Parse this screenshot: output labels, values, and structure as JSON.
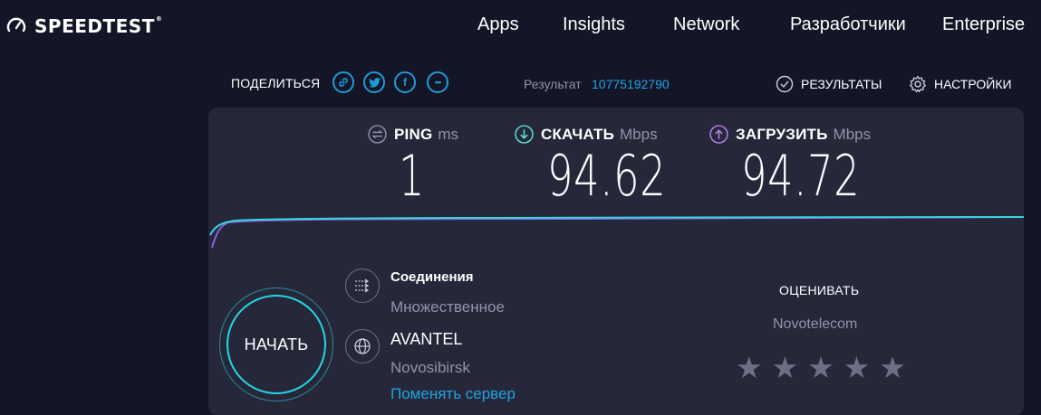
{
  "header": {
    "logo": "SPEEDTEST",
    "logo_tm": "®",
    "nav": [
      "Apps",
      "Insights",
      "Network",
      "Разработчики",
      "Enterprise"
    ]
  },
  "share": {
    "label": "ПОДЕЛИТЬСЯ",
    "buttons": [
      "link-icon",
      "twitter-icon",
      "facebook-icon",
      "more-icon"
    ],
    "facebook_glyph": "f",
    "more_glyph": "•••"
  },
  "result": {
    "label": "Результат",
    "id": "10775192790"
  },
  "links": {
    "results": "РЕЗУЛЬТАТЫ",
    "settings": "НАСТРОЙКИ"
  },
  "metrics": {
    "ping": {
      "name": "PING",
      "unit": "ms",
      "value": "1"
    },
    "download": {
      "name": "СКАЧАТЬ",
      "unit": "Mbps",
      "value": "94.62"
    },
    "upload": {
      "name": "ЗАГРУЗИТЬ",
      "unit": "Mbps",
      "value": "94.72"
    }
  },
  "start_button": "НАЧАТЬ",
  "connections": {
    "title": "Соединения",
    "value": "Множественное"
  },
  "server": {
    "name": "AVANTEL",
    "city": "Novosibirsk",
    "change": "Поменять сервер"
  },
  "rating": {
    "label": "ОЦЕНИВАТЬ",
    "isp": "Novotelecom",
    "stars": 5,
    "star_glyph": "★"
  },
  "colors": {
    "background": "#141526",
    "card": "#26283a",
    "accent_cyan": "#24d7e3",
    "accent_purple": "#9b6ee8",
    "link_blue": "#1fa3e3"
  }
}
